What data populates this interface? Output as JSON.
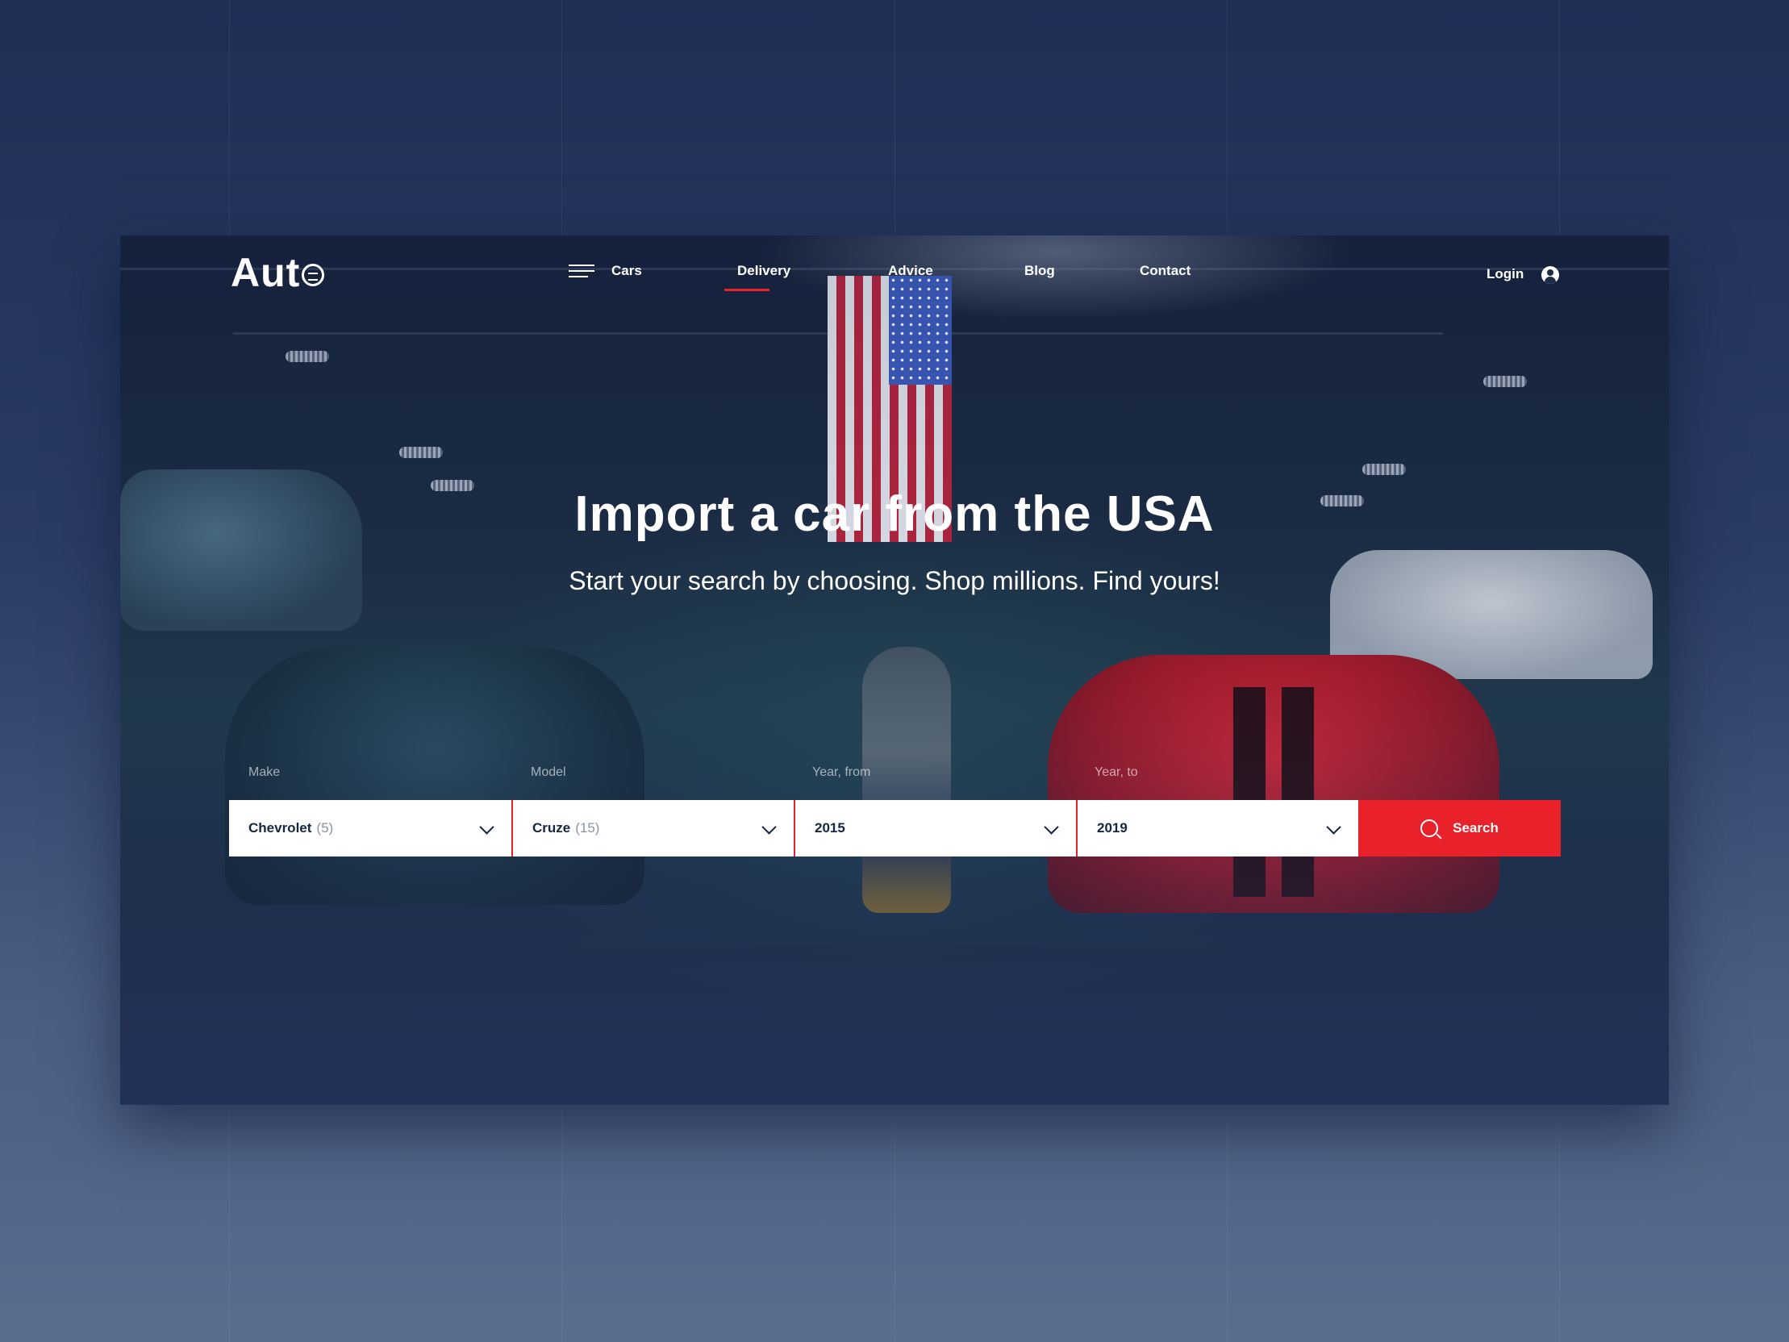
{
  "brand": {
    "logo_text": "Aut"
  },
  "nav": {
    "items": [
      {
        "label": "Cars"
      },
      {
        "label": "Delivery"
      },
      {
        "label": "Advice"
      },
      {
        "label": "Blog"
      },
      {
        "label": "Contact"
      }
    ],
    "active": "Delivery",
    "login_label": "Login"
  },
  "hero": {
    "title": "Import a car from the USA",
    "subtitle": "Start your search by choosing. Shop millions. Find yours!"
  },
  "search": {
    "fields": [
      {
        "label": "Make",
        "value": "Chevrolet",
        "count": "(5)"
      },
      {
        "label": "Model",
        "value": "Cruze",
        "count": "(15)"
      },
      {
        "label": "Year, from",
        "value": "2015",
        "count": ""
      },
      {
        "label": "Year, to",
        "value": "2019",
        "count": ""
      }
    ],
    "button_label": "Search"
  },
  "colors": {
    "accent": "#e8212a",
    "navy": "#152544",
    "page_bg": "#24355e"
  },
  "icons": [
    "menu-icon",
    "user-icon",
    "chevron-down-icon",
    "search-icon",
    "logo-wheel-icon"
  ]
}
